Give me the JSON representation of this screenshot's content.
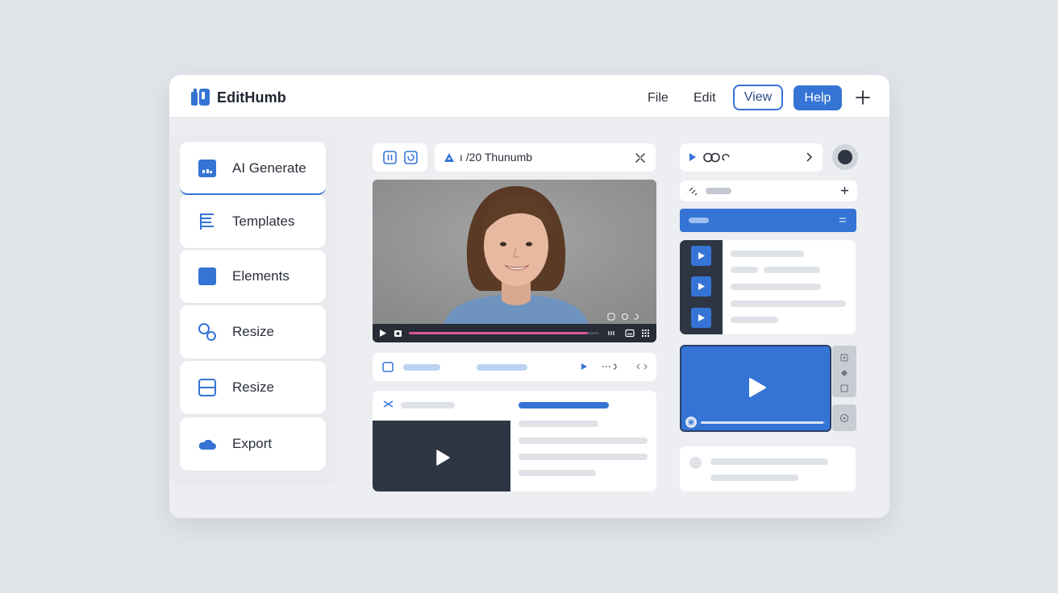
{
  "app": {
    "title": "EditHumb"
  },
  "menu": {
    "file": "File",
    "edit": "Edit",
    "view": "View",
    "help": "Help"
  },
  "sidebar": {
    "items": [
      {
        "label": "AI Generate",
        "icon": "ai-generate-icon",
        "active": true
      },
      {
        "label": "Templates",
        "icon": "templates-icon"
      },
      {
        "label": "Elements",
        "icon": "elements-icon"
      },
      {
        "label": "Resize",
        "icon": "circles-icon"
      },
      {
        "label": "Resize",
        "icon": "layout-icon"
      },
      {
        "label": "Export",
        "icon": "cloud-icon"
      }
    ]
  },
  "editor": {
    "title_field": "ı /20 Thunumb",
    "video_progress": 0.94
  },
  "right_panel": {
    "preview_progress": 0.99
  },
  "colors": {
    "accent": "#3574d4",
    "dark_panel": "#2e3543",
    "progress": "#e0559d",
    "background": "#e1e4e9"
  }
}
